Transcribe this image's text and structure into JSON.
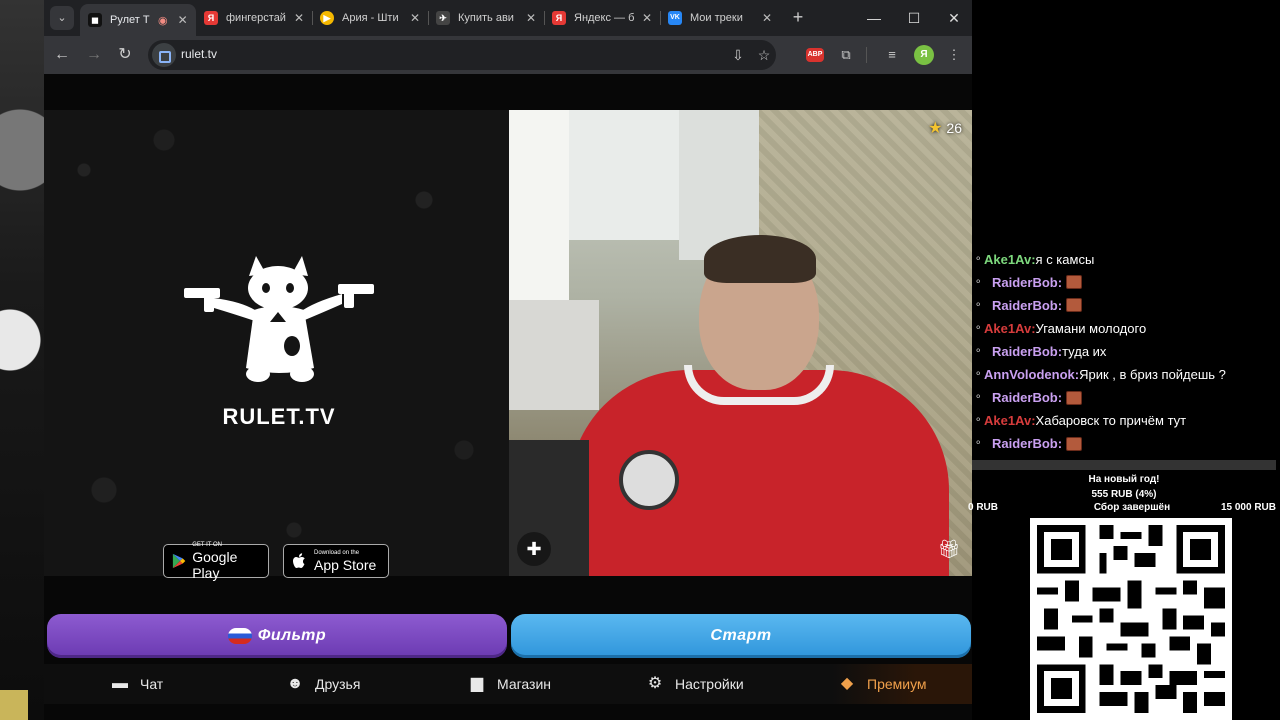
{
  "browser": {
    "tabs": [
      {
        "label": "Рулет Т",
        "favicon_color": "#111111",
        "favicon_glyph": "▮",
        "active": true
      },
      {
        "label": "фингерстай",
        "favicon_color": "#e53935",
        "favicon_glyph": "Я"
      },
      {
        "label": "Ария - Шти",
        "favicon_color": "#f5b800",
        "favicon_glyph": "▶"
      },
      {
        "label": "Купить ави",
        "favicon_color": "#444444",
        "favicon_glyph": "✈"
      },
      {
        "label": "Яндекс — б",
        "favicon_color": "#e53935",
        "favicon_glyph": "Я"
      },
      {
        "label": "Мои треки",
        "favicon_color": "#2787f5",
        "favicon_glyph": "VK"
      }
    ],
    "url": "rulet.tv",
    "abp_label": "ABP",
    "profile_initial": "Я"
  },
  "page": {
    "logo_text": "RULET.TV",
    "google_play": {
      "sub": "GET IT ON",
      "main": "Google Play"
    },
    "app_store": {
      "sub": "Download on the",
      "main": "App Store"
    },
    "rating": "26",
    "filter_button": "Фильтр",
    "start_button": "Старт",
    "nav": [
      {
        "label": "Чат",
        "icon": "chat-icon"
      },
      {
        "label": "Друзья",
        "icon": "friends-icon"
      },
      {
        "label": "Магазин",
        "icon": "shop-bag-icon"
      },
      {
        "label": "Настройки",
        "icon": "gear-icon"
      },
      {
        "label": "Премиум",
        "icon": "price-tag-icon"
      }
    ]
  },
  "overlay": {
    "chat": [
      {
        "user": "Ake1Av:",
        "color": "#7dd87d",
        "text": "я с камсы",
        "emote": false
      },
      {
        "user": "RaiderBob:",
        "color": "#c9a0f0",
        "text": "",
        "emote": true
      },
      {
        "user": "RaiderBob:",
        "color": "#c9a0f0",
        "text": "",
        "emote": true
      },
      {
        "user": "Ake1Av:",
        "color": "#d63c3c",
        "text": "Угамани молодого",
        "emote": false
      },
      {
        "user": "RaiderBob:",
        "color": "#c9a0f0",
        "text": "туда их",
        "emote": false
      },
      {
        "user": "AnnVolodenok:",
        "color": "#c9a0f0",
        "text": "Ярик , в бриз пойдешь ?",
        "emote": false
      },
      {
        "user": "RaiderBob:",
        "color": "#c9a0f0",
        "text": "",
        "emote": true
      },
      {
        "user": "Ake1Av:",
        "color": "#d63c3c",
        "text": "Хабаровск то причём тут",
        "emote": false
      },
      {
        "user": "RaiderBob:",
        "color": "#c9a0f0",
        "text": "",
        "emote": true
      }
    ],
    "goal": {
      "title": "На новый год!",
      "amount": "555 RUB (4%)",
      "start": "0 RUB",
      "status": "Сбор завершён",
      "end": "15 000 RUB"
    }
  }
}
